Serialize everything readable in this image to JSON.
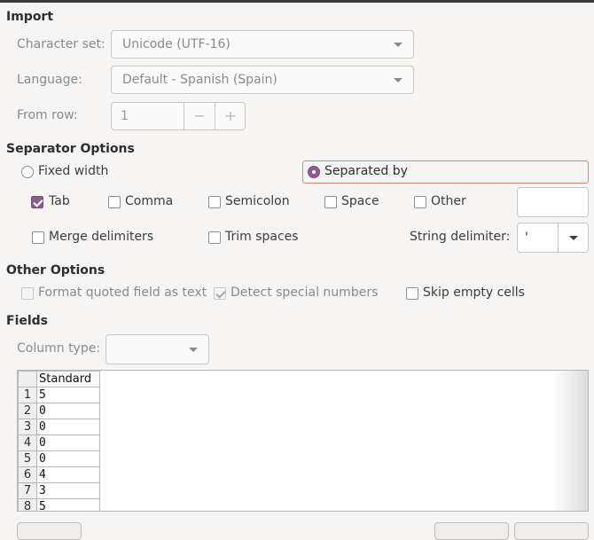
{
  "import": {
    "heading": "Import",
    "charset_label": "Character set:",
    "charset_value": "Unicode (UTF-16)",
    "language_label": "Language:",
    "language_value": "Default - Spanish (Spain)",
    "from_row_label": "From row:",
    "from_row_value": "1",
    "minus": "−",
    "plus": "+"
  },
  "separator": {
    "heading": "Separator Options",
    "fixed_width": "Fixed width",
    "separated_by": "Separated by",
    "tab": "Tab",
    "comma": "Comma",
    "semicolon": "Semicolon",
    "space": "Space",
    "other": "Other",
    "merge": "Merge delimiters",
    "trim": "Trim spaces",
    "string_delim_label": "String delimiter:",
    "string_delim_value": "'"
  },
  "other_options": {
    "heading": "Other Options",
    "format_quoted": "Format quoted field as text",
    "detect_special": "Detect special numbers",
    "skip_empty": "Skip empty cells"
  },
  "fields": {
    "heading": "Fields",
    "column_type_label": "Column type:",
    "column_header": "Standard",
    "rows": [
      {
        "n": "1",
        "v": "5"
      },
      {
        "n": "2",
        "v": "0"
      },
      {
        "n": "3",
        "v": "0"
      },
      {
        "n": "4",
        "v": "0"
      },
      {
        "n": "5",
        "v": "0"
      },
      {
        "n": "6",
        "v": "4"
      },
      {
        "n": "7",
        "v": "3"
      },
      {
        "n": "8",
        "v": "5"
      }
    ]
  }
}
